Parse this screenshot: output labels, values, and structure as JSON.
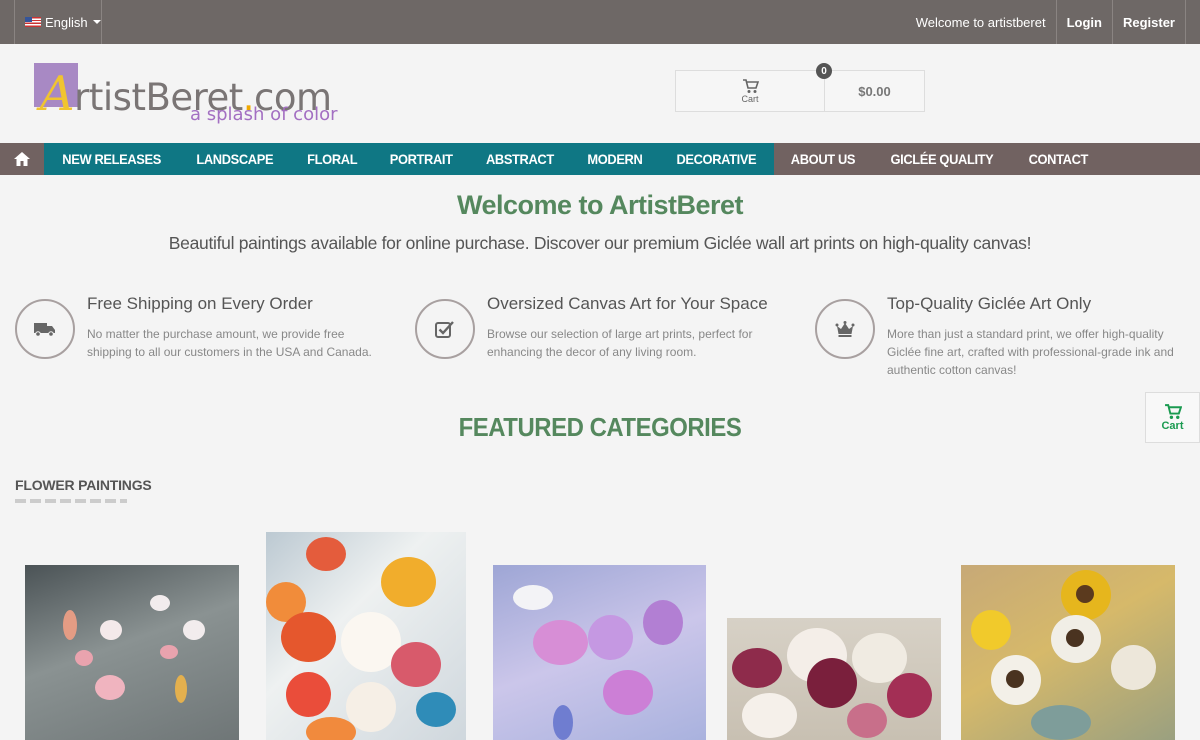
{
  "topbar": {
    "language": "English",
    "welcome": "Welcome to artistberet",
    "login": "Login",
    "register": "Register"
  },
  "logo": {
    "letter": "A",
    "main": "rtistBeret",
    "dot": ".",
    "tld": "com",
    "tagline": "a splash of color"
  },
  "cart": {
    "label": "Cart",
    "count": "0",
    "total": "$0.00"
  },
  "nav": {
    "home_icon": "home-icon",
    "teal_items": [
      "NEW RELEASES",
      "LANDSCAPE",
      "FLORAL",
      "PORTRAIT",
      "ABSTRACT",
      "MODERN",
      "DECORATIVE"
    ],
    "plain_items": [
      "ABOUT US",
      "GICLÉE QUALITY",
      "CONTACT"
    ]
  },
  "hero": {
    "title": "Welcome to ArtistBeret",
    "subtitle": "Beautiful paintings available for online purchase. Discover our premium Giclée wall art prints on high-quality canvas!"
  },
  "features": [
    {
      "icon": "truck-icon",
      "title": "Free Shipping on Every Order",
      "desc": "No matter the purchase amount, we provide free shipping to all our customers in the USA and Canada."
    },
    {
      "icon": "checkbox-icon",
      "title": "Oversized Canvas Art for Your Space",
      "desc": "Browse our selection of large art prints, perfect for enhancing the decor of any living room."
    },
    {
      "icon": "crown-icon",
      "title": "Top-Quality Giclée Art Only",
      "desc": "More than just a standard print, we offer high-quality Giclée fine art, crafted with professional-grade ink and authentic cotton canvas!"
    }
  ],
  "featured_heading": "FEATURED CATEGORIES",
  "category": {
    "title": "FLOWER PAINTINGS"
  },
  "side_cart": {
    "label": "Cart"
  },
  "colors": {
    "topbar": "#6e6866",
    "nav": "#716261",
    "nav_teal": "#0f7784",
    "heading_green": "#55885e",
    "cart_green": "#1a9a50"
  }
}
